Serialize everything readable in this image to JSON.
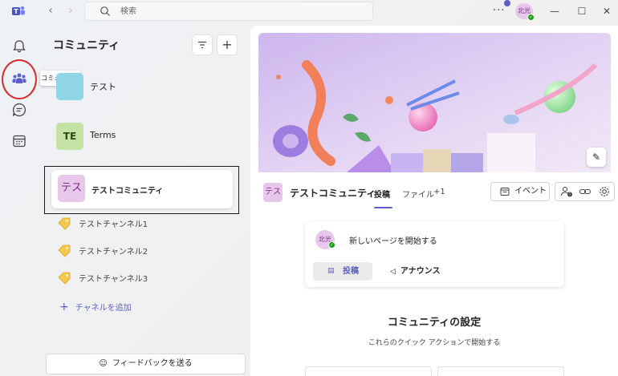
{
  "titlebar": {
    "search_placeholder": "検索",
    "more_label": "···",
    "avatar_initials": "北光",
    "minimize": "—",
    "maximize": "☐",
    "close": "✕"
  },
  "rail": {
    "tooltip": "コミュニティ",
    "highlight_color": "#d62b2b"
  },
  "pane": {
    "title": "コミュニティ",
    "communities": [
      {
        "avatar": "",
        "label": "テスト"
      },
      {
        "avatar": "TE",
        "label": "Terms"
      },
      {
        "avatar": "テス",
        "label": "テストコミュニティ"
      }
    ],
    "channels": [
      {
        "label": "テストチャンネル1"
      },
      {
        "label": "テストチャンネル2"
      },
      {
        "label": "テストチャンネル3"
      }
    ],
    "add_channel": "チャネルを追加",
    "feedback": "フィードバックを送る"
  },
  "main": {
    "avatar": "テス",
    "title": "テストコミュニティ",
    "tabs": [
      {
        "label": "投稿"
      },
      {
        "label": "ファイル"
      },
      {
        "label": "+1"
      }
    ],
    "event_button": "イベント",
    "composer": {
      "avatar": "北光",
      "prompt": "新しいページを開始する",
      "post_button": "投稿",
      "announce_button": "アナウンス"
    },
    "settings": {
      "title": "コミュニティの設定",
      "subtitle": "これらのクイック アクションで開始する"
    }
  },
  "colors": {
    "accent": "#5b5fc7",
    "terms_avatar_bg": "#c3e2a4",
    "community_avatar_bg": "#e7c8ea",
    "status_green": "#13a10e"
  }
}
